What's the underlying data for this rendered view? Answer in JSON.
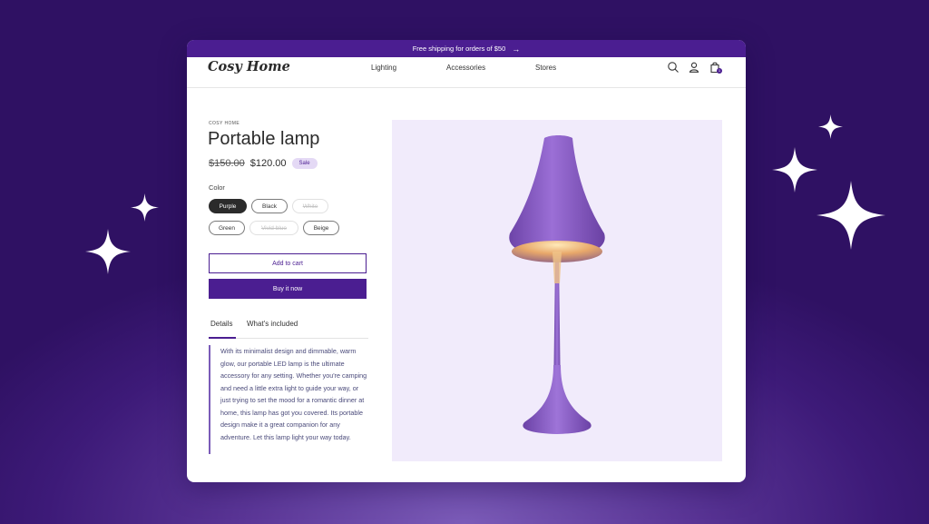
{
  "announcement": {
    "text": "Free shipping for orders of $50",
    "arrow": "→"
  },
  "header": {
    "logo": "Cosy Home",
    "nav": [
      "Lighting",
      "Accessories",
      "Stores"
    ],
    "icons": [
      "search-icon",
      "account-icon",
      "cart-icon"
    ],
    "cart_count": "1"
  },
  "product": {
    "vendor": "COSY HOME",
    "title": "Portable lamp",
    "original_price": "$150.00",
    "sale_price": "$120.00",
    "badge": "Sale",
    "color_label": "Color",
    "colors": [
      {
        "label": "Purple",
        "state": "selected"
      },
      {
        "label": "Black",
        "state": "available"
      },
      {
        "label": "White",
        "state": "sold-out"
      },
      {
        "label": "Green",
        "state": "available"
      },
      {
        "label": "Vivid blue",
        "state": "sold-out"
      },
      {
        "label": "Beige",
        "state": "available"
      }
    ],
    "add_to_cart": "Add to cart",
    "buy_now": "Buy it now",
    "tabs": [
      "Details",
      "What's included"
    ],
    "active_tab": "Details",
    "description": "With its minimalist design and dimmable, warm glow, our portable LED lamp is the ultimate accessory for any setting. Whether you're camping and need a little extra light to guide your way, or just trying to set the mood for a romantic dinner at home, this lamp has got you covered. Its portable design make it a great companion for any adventure. Let this lamp light your way today."
  },
  "colors": {
    "brand": "#4b1e91",
    "badge_bg": "#e4d9f5",
    "image_bg": "#f1ebfb",
    "lamp": "#8a5cc7"
  }
}
